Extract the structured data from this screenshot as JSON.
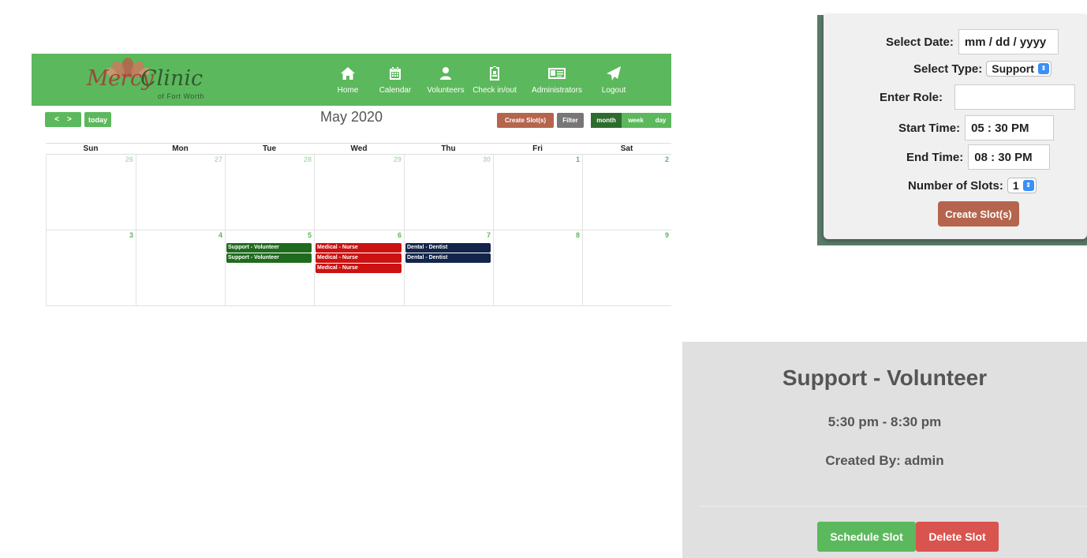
{
  "app": {
    "logo": {
      "main1": "Mercy",
      "main2": "Clinic",
      "sub": "of Fort Worth"
    },
    "nav": [
      {
        "label": "Home",
        "icon": "home-icon"
      },
      {
        "label": "Calendar",
        "icon": "calendar-icon"
      },
      {
        "label": "Volunteers",
        "icon": "user-icon"
      },
      {
        "label": "Check in/out",
        "icon": "badge-icon"
      },
      {
        "label": "Administrators",
        "icon": "id-card-icon"
      },
      {
        "label": "Logout",
        "icon": "paper-plane-icon"
      }
    ],
    "toolbar": {
      "prev": "<",
      "next": ">",
      "today": "today",
      "title": "May 2020",
      "create": "Create Slot(s)",
      "filter": "Filter",
      "views": [
        "month",
        "week",
        "day"
      ],
      "active_view": "month"
    },
    "calendar": {
      "weekdays": [
        "Sun",
        "Mon",
        "Tue",
        "Wed",
        "Thu",
        "Fri",
        "Sat"
      ],
      "weeks": [
        [
          {
            "day": "26",
            "other": true,
            "events": []
          },
          {
            "day": "27",
            "other": true,
            "events": []
          },
          {
            "day": "28",
            "other": true,
            "events": []
          },
          {
            "day": "29",
            "other": true,
            "events": []
          },
          {
            "day": "30",
            "other": true,
            "events": []
          },
          {
            "day": "1",
            "other": false,
            "events": []
          },
          {
            "day": "2",
            "other": false,
            "events": []
          }
        ],
        [
          {
            "day": "3",
            "other": false,
            "events": []
          },
          {
            "day": "4",
            "other": false,
            "events": []
          },
          {
            "day": "5",
            "other": false,
            "events": [
              {
                "title": "Support - Volunteer",
                "color": "#1e6b1e"
              },
              {
                "title": "Support - Volunteer",
                "color": "#1e6b1e"
              }
            ]
          },
          {
            "day": "6",
            "other": false,
            "events": [
              {
                "title": "Medical - Nurse",
                "color": "#cc1111"
              },
              {
                "title": "Medical - Nurse",
                "color": "#cc1111"
              },
              {
                "title": "Medical - Nurse",
                "color": "#cc1111"
              }
            ]
          },
          {
            "day": "7",
            "other": false,
            "events": [
              {
                "title": "Dental - Dentist",
                "color": "#13254a"
              },
              {
                "title": "Dental - Dentist",
                "color": "#13254a"
              }
            ]
          },
          {
            "day": "8",
            "other": false,
            "events": []
          },
          {
            "day": "9",
            "other": false,
            "events": []
          }
        ]
      ]
    }
  },
  "form": {
    "date_label": "Select Date:",
    "date_value": "mm / dd / yyyy",
    "type_label": "Select Type:",
    "type_value": "Support",
    "role_label": "Enter Role:",
    "role_value": "",
    "start_label": "Start Time:",
    "start_value": "05 : 30  PM",
    "end_label": "End Time:",
    "end_value": "08 : 30  PM",
    "slots_label": "Number of Slots:",
    "slots_value": "1",
    "submit": "Create Slot(s)"
  },
  "detail": {
    "title": "Support - Volunteer",
    "time": "5:30 pm - 8:30 pm",
    "created_by": "Created By: admin",
    "schedule": "Schedule Slot",
    "delete": "Delete Slot"
  },
  "colors": {
    "brand_green": "#5cb85c",
    "dark_green": "#2e6b2e",
    "create_brown": "#b5654d",
    "delete_red": "#d9534f"
  }
}
